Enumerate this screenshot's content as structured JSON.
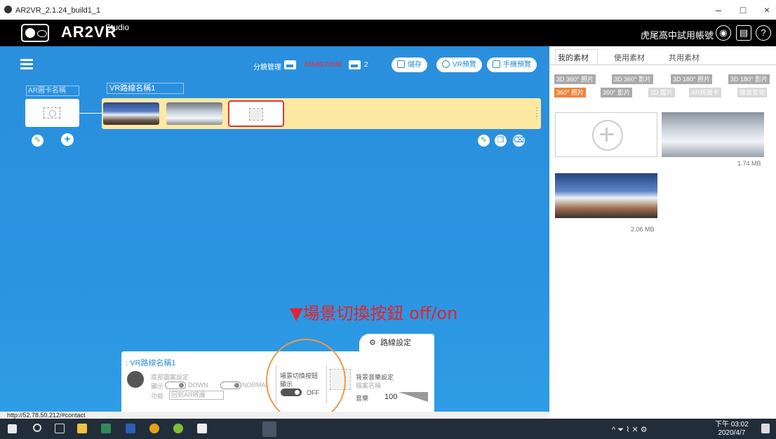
{
  "window": {
    "title": "AR2VR_2.1.24_build1_1",
    "controls": [
      "–",
      "□",
      "×"
    ]
  },
  "header": {
    "logo_text": "AR2VR",
    "logo_sup": "Studio",
    "account": "虎尾高中試用帳號",
    "icons": [
      "user-icon",
      "notebook-icon",
      "help-icon"
    ],
    "help_glyph": "?"
  },
  "toolbar": {
    "segment_label": "分鏡管理",
    "storage": "46MB/20MB",
    "vr_count": "2",
    "save_label": "儲存",
    "vr_preview_label": "VR預覽",
    "mobile_preview_label": "手機預覽"
  },
  "editor": {
    "ar_card_label": "AR圖卡名稱",
    "vr_route_label": "VR路線名稱1",
    "annotation": "▼場景切換按鈕 off/on"
  },
  "route_panel": {
    "tab_label": "路線設定",
    "title": ": VR路線名稱1",
    "bottom_image_setting": "底部圖案設定",
    "show_label": "顯示",
    "down_label": "DOWN",
    "normal_label": "NORMAL",
    "function_label": "功能",
    "function_value": "回到AR辨識",
    "scene_switch_label": "場景切換按鈕",
    "scene_show_label": "顯示",
    "scene_switch_state": "OFF",
    "music_setting": "背景音樂設定",
    "music_name_label": "檔案名稱",
    "volume_label": "音樂",
    "volume_value": "100"
  },
  "assets": {
    "tabs": [
      "我的素材",
      "使用素材",
      "共用素材"
    ],
    "filters_row1": [
      "3D 360° 照片",
      "3D 360° 影片",
      "3D 180° 照片",
      "3D 180° 影片"
    ],
    "filters_row2": [
      "360° 照片",
      "360° 影片",
      "2D 圖片",
      "AR辨識卡",
      "錄音音效"
    ],
    "active_filter": "360° 照片",
    "items": [
      {
        "size": "1.74 MB"
      },
      {
        "size": "2.06 MB"
      }
    ]
  },
  "status_bar": {
    "url": "http://52.78.50.212/#contact"
  },
  "taskbar": {
    "time": "下午 03:02",
    "date": "2020/4/7",
    "tray": "^ ⏷ ⌇ ✕ ⚙"
  }
}
